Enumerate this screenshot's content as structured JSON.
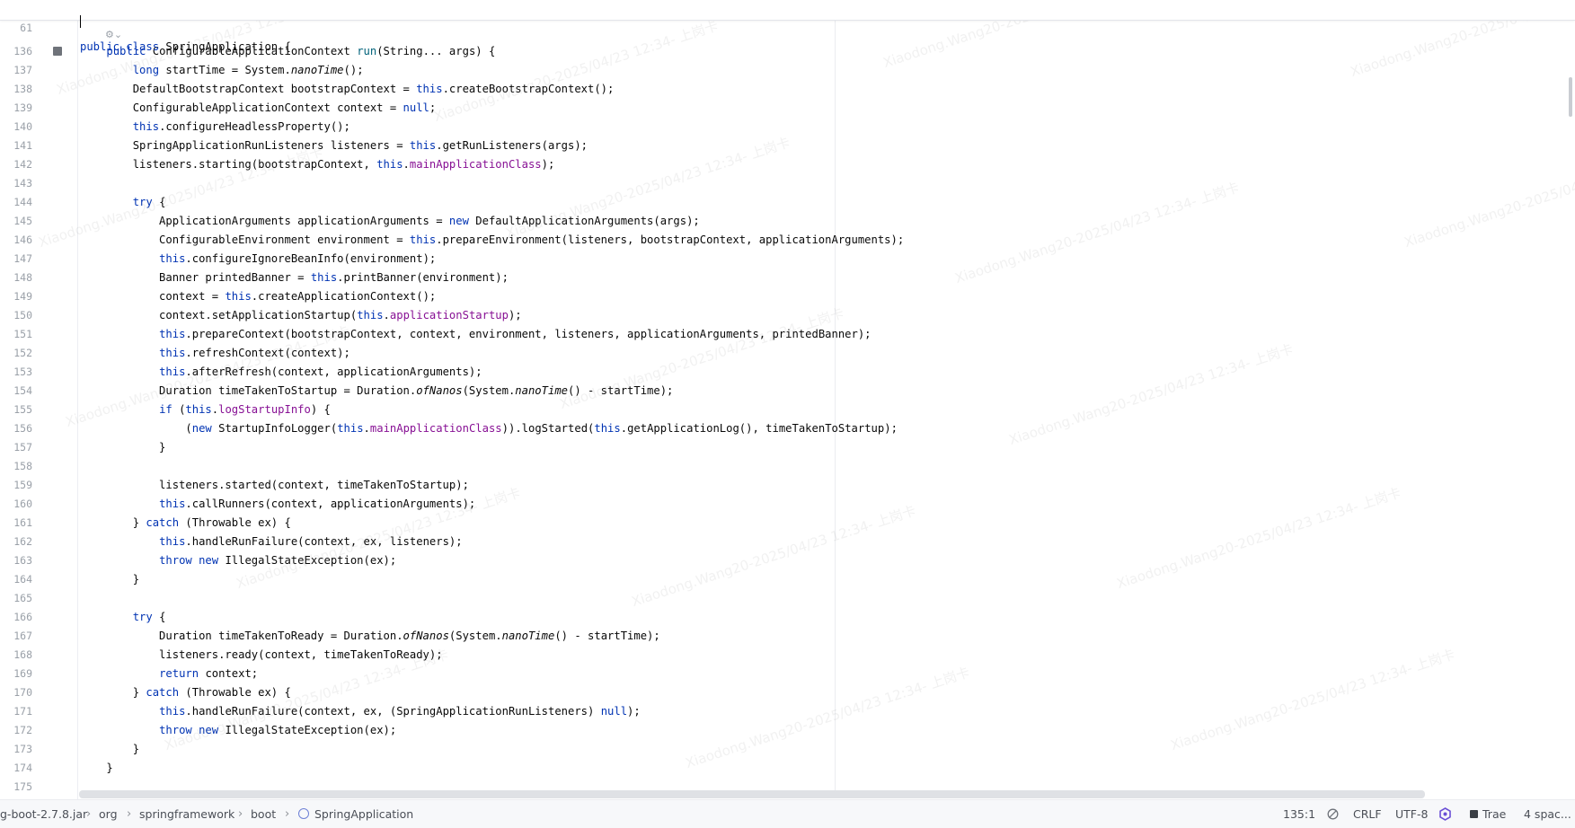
{
  "editor": {
    "sticky": {
      "line_number": "61",
      "tokens": [
        {
          "t": "public class ",
          "c": "kw"
        },
        {
          "t": "SpringApplication {",
          "c": "plain"
        }
      ]
    },
    "lines": [
      {
        "n": "136",
        "tokens": [
          {
            "t": "    "
          },
          {
            "t": "public ",
            "c": "kw"
          },
          {
            "t": "ConfigurableApplicationContext "
          },
          {
            "t": "run",
            "c": "mth"
          },
          {
            "t": "(String... args) {"
          }
        ]
      },
      {
        "n": "137",
        "tokens": [
          {
            "t": "        "
          },
          {
            "t": "long ",
            "c": "kw"
          },
          {
            "t": "startTime = System."
          },
          {
            "t": "nanoTime",
            "c": "it"
          },
          {
            "t": "();"
          }
        ]
      },
      {
        "n": "138",
        "tokens": [
          {
            "t": "        DefaultBootstrapContext bootstrapContext = "
          },
          {
            "t": "this",
            "c": "kw"
          },
          {
            "t": ".createBootstrapContext();"
          }
        ]
      },
      {
        "n": "139",
        "tokens": [
          {
            "t": "        ConfigurableApplicationContext context = "
          },
          {
            "t": "null",
            "c": "kw"
          },
          {
            "t": ";"
          }
        ]
      },
      {
        "n": "140",
        "tokens": [
          {
            "t": "        "
          },
          {
            "t": "this",
            "c": "kw"
          },
          {
            "t": ".configureHeadlessProperty();"
          }
        ]
      },
      {
        "n": "141",
        "tokens": [
          {
            "t": "        SpringApplicationRunListeners listeners = "
          },
          {
            "t": "this",
            "c": "kw"
          },
          {
            "t": ".getRunListeners(args);"
          }
        ]
      },
      {
        "n": "142",
        "tokens": [
          {
            "t": "        listeners.starting(bootstrapContext, "
          },
          {
            "t": "this",
            "c": "kw"
          },
          {
            "t": "."
          },
          {
            "t": "mainApplicationClass",
            "c": "fld"
          },
          {
            "t": ");"
          }
        ]
      },
      {
        "n": "143",
        "tokens": []
      },
      {
        "n": "144",
        "tokens": [
          {
            "t": "        "
          },
          {
            "t": "try ",
            "c": "kw"
          },
          {
            "t": "{"
          }
        ]
      },
      {
        "n": "145",
        "tokens": [
          {
            "t": "            ApplicationArguments applicationArguments = "
          },
          {
            "t": "new ",
            "c": "kw"
          },
          {
            "t": "DefaultApplicationArguments(args);"
          }
        ]
      },
      {
        "n": "146",
        "tokens": [
          {
            "t": "            ConfigurableEnvironment environment = "
          },
          {
            "t": "this",
            "c": "kw"
          },
          {
            "t": ".prepareEnvironment(listeners, bootstrapContext, applicationArguments);"
          }
        ]
      },
      {
        "n": "147",
        "tokens": [
          {
            "t": "            "
          },
          {
            "t": "this",
            "c": "kw"
          },
          {
            "t": ".configureIgnoreBeanInfo(environment);"
          }
        ]
      },
      {
        "n": "148",
        "tokens": [
          {
            "t": "            Banner printedBanner = "
          },
          {
            "t": "this",
            "c": "kw"
          },
          {
            "t": ".printBanner(environment);"
          }
        ]
      },
      {
        "n": "149",
        "tokens": [
          {
            "t": "            context = "
          },
          {
            "t": "this",
            "c": "kw"
          },
          {
            "t": ".createApplicationContext();"
          }
        ]
      },
      {
        "n": "150",
        "tokens": [
          {
            "t": "            context.setApplicationStartup("
          },
          {
            "t": "this",
            "c": "kw"
          },
          {
            "t": "."
          },
          {
            "t": "applicationStartup",
            "c": "fld"
          },
          {
            "t": ");"
          }
        ]
      },
      {
        "n": "151",
        "tokens": [
          {
            "t": "            "
          },
          {
            "t": "this",
            "c": "kw"
          },
          {
            "t": ".prepareContext(bootstrapContext, context, environment, listeners, applicationArguments, printedBanner);"
          }
        ]
      },
      {
        "n": "152",
        "tokens": [
          {
            "t": "            "
          },
          {
            "t": "this",
            "c": "kw"
          },
          {
            "t": ".refreshContext(context);"
          }
        ]
      },
      {
        "n": "153",
        "tokens": [
          {
            "t": "            "
          },
          {
            "t": "this",
            "c": "kw"
          },
          {
            "t": ".afterRefresh(context, applicationArguments);"
          }
        ]
      },
      {
        "n": "154",
        "tokens": [
          {
            "t": "            Duration timeTakenToStartup = Duration."
          },
          {
            "t": "ofNanos",
            "c": "it"
          },
          {
            "t": "(System."
          },
          {
            "t": "nanoTime",
            "c": "it"
          },
          {
            "t": "() - startTime);"
          }
        ]
      },
      {
        "n": "155",
        "tokens": [
          {
            "t": "            "
          },
          {
            "t": "if ",
            "c": "kw"
          },
          {
            "t": "("
          },
          {
            "t": "this",
            "c": "kw"
          },
          {
            "t": "."
          },
          {
            "t": "logStartupInfo",
            "c": "fld"
          },
          {
            "t": ") {"
          }
        ]
      },
      {
        "n": "156",
        "tokens": [
          {
            "t": "                ("
          },
          {
            "t": "new ",
            "c": "kw"
          },
          {
            "t": "StartupInfoLogger("
          },
          {
            "t": "this",
            "c": "kw"
          },
          {
            "t": "."
          },
          {
            "t": "mainApplicationClass",
            "c": "fld"
          },
          {
            "t": ")).logStarted("
          },
          {
            "t": "this",
            "c": "kw"
          },
          {
            "t": ".getApplicationLog(), timeTakenToStartup);"
          }
        ]
      },
      {
        "n": "157",
        "tokens": [
          {
            "t": "            }"
          }
        ]
      },
      {
        "n": "158",
        "tokens": []
      },
      {
        "n": "159",
        "tokens": [
          {
            "t": "            listeners.started(context, timeTakenToStartup);"
          }
        ]
      },
      {
        "n": "160",
        "tokens": [
          {
            "t": "            "
          },
          {
            "t": "this",
            "c": "kw"
          },
          {
            "t": ".callRunners(context, applicationArguments);"
          }
        ]
      },
      {
        "n": "161",
        "tokens": [
          {
            "t": "        } "
          },
          {
            "t": "catch ",
            "c": "kw"
          },
          {
            "t": "(Throwable ex) {"
          }
        ]
      },
      {
        "n": "162",
        "tokens": [
          {
            "t": "            "
          },
          {
            "t": "this",
            "c": "kw"
          },
          {
            "t": ".handleRunFailure(context, ex, listeners);"
          }
        ]
      },
      {
        "n": "163",
        "tokens": [
          {
            "t": "            "
          },
          {
            "t": "throw new ",
            "c": "kw"
          },
          {
            "t": "IllegalStateException(ex);"
          }
        ]
      },
      {
        "n": "164",
        "tokens": [
          {
            "t": "        }"
          }
        ]
      },
      {
        "n": "165",
        "tokens": []
      },
      {
        "n": "166",
        "tokens": [
          {
            "t": "        "
          },
          {
            "t": "try ",
            "c": "kw"
          },
          {
            "t": "{"
          }
        ]
      },
      {
        "n": "167",
        "tokens": [
          {
            "t": "            Duration timeTakenToReady = Duration."
          },
          {
            "t": "ofNanos",
            "c": "it"
          },
          {
            "t": "(System."
          },
          {
            "t": "nanoTime",
            "c": "it"
          },
          {
            "t": "() - startTime);"
          }
        ]
      },
      {
        "n": "168",
        "tokens": [
          {
            "t": "            listeners.ready(context, timeTakenToReady);"
          }
        ]
      },
      {
        "n": "169",
        "tokens": [
          {
            "t": "            "
          },
          {
            "t": "return ",
            "c": "kw"
          },
          {
            "t": "context;"
          }
        ]
      },
      {
        "n": "170",
        "tokens": [
          {
            "t": "        } "
          },
          {
            "t": "catch ",
            "c": "kw"
          },
          {
            "t": "(Throwable ex) {"
          }
        ]
      },
      {
        "n": "171",
        "tokens": [
          {
            "t": "            "
          },
          {
            "t": "this",
            "c": "kw"
          },
          {
            "t": ".handleRunFailure(context, ex, (SpringApplicationRunListeners) "
          },
          {
            "t": "null",
            "c": "kw"
          },
          {
            "t": ");"
          }
        ]
      },
      {
        "n": "172",
        "tokens": [
          {
            "t": "            "
          },
          {
            "t": "throw new ",
            "c": "kw"
          },
          {
            "t": "IllegalStateException(ex);"
          }
        ]
      },
      {
        "n": "173",
        "tokens": [
          {
            "t": "        }"
          }
        ]
      },
      {
        "n": "174",
        "tokens": [
          {
            "t": "    }"
          }
        ]
      },
      {
        "n": "175",
        "tokens": []
      }
    ],
    "watermark_text": "Xiaodong.Wang20-2025/04/23  12:34- 上岗卡"
  },
  "statusbar": {
    "breadcrumbs": [
      {
        "label": "g-boot-2.7.8.jar"
      },
      {
        "label": "org"
      },
      {
        "label": "springframework"
      },
      {
        "label": "boot"
      },
      {
        "label": "SpringApplication",
        "icon": "spring-class-icon"
      }
    ],
    "caret_position": "135:1",
    "line_separator": "CRLF",
    "encoding": "UTF-8",
    "plugin": "Trae",
    "indent": "4 spac..."
  },
  "colors": {
    "keyword": "#0033b3",
    "field": "#871094",
    "method": "#00627a",
    "line_number": "#9aa0a8",
    "statusbar_bg": "#f7f8fa"
  }
}
